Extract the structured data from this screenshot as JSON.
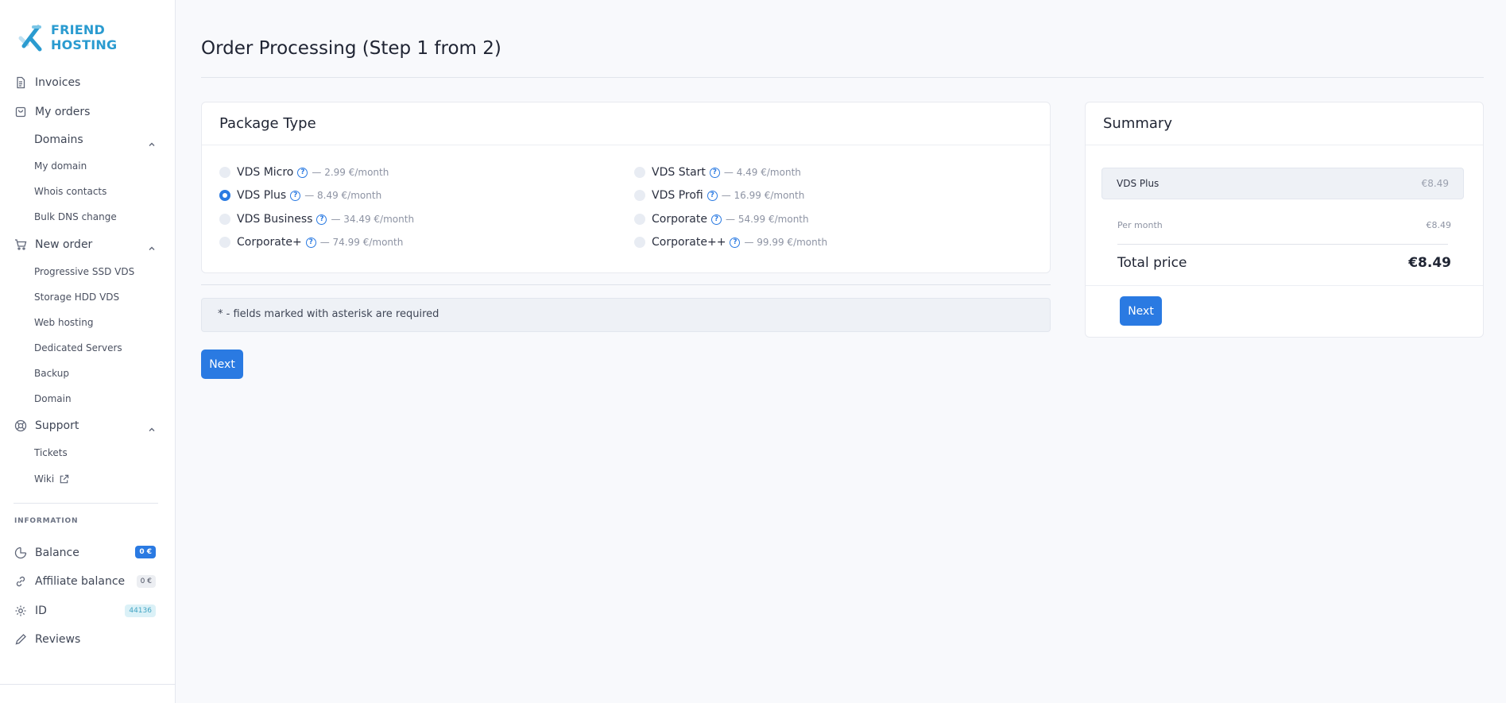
{
  "brand": {
    "name": "FRIEND HOSTING",
    "accent": "#2a9bd0",
    "primary": "#2a7ae2"
  },
  "sidebar": {
    "invoices": "Invoices",
    "my_orders": "My orders",
    "domains": {
      "label": "Domains",
      "items": [
        "My domain",
        "Whois contacts",
        "Bulk DNS change"
      ]
    },
    "new_order": {
      "label": "New order",
      "items": [
        "Progressive SSD VDS",
        "Storage HDD VDS",
        "Web hosting",
        "Dedicated Servers",
        "Backup",
        "Domain"
      ]
    },
    "support": {
      "label": "Support",
      "items": [
        "Tickets",
        "Wiki"
      ]
    },
    "information_label": "INFORMATION",
    "balance": {
      "label": "Balance",
      "badge": "0 €"
    },
    "affiliate": {
      "label": "Affiliate balance",
      "badge": "0 €"
    },
    "id": {
      "label": "ID",
      "badge": "44136"
    },
    "reviews": "Reviews"
  },
  "page": {
    "title": "Order Processing (Step 1 from 2)",
    "package_card_title": "Package Type",
    "packages": [
      {
        "name": "VDS Micro",
        "price": "— 2.99 €/month",
        "selected": false
      },
      {
        "name": "VDS Plus",
        "price": "— 8.49 €/month",
        "selected": true
      },
      {
        "name": "VDS Business",
        "price": "— 34.49 €/month",
        "selected": false
      },
      {
        "name": "Corporate+",
        "price": "— 74.99 €/month",
        "selected": false
      },
      {
        "name": "VDS Start",
        "price": "— 4.49 €/month",
        "selected": false
      },
      {
        "name": "VDS Profi",
        "price": "— 16.99 €/month",
        "selected": false
      },
      {
        "name": "Corporate",
        "price": "— 54.99 €/month",
        "selected": false
      },
      {
        "name": "Corporate++",
        "price": "— 99.99 €/month",
        "selected": false
      }
    ],
    "required_note": "* - fields marked with asterisk are required",
    "next_label": "Next"
  },
  "summary": {
    "title": "Summary",
    "selected_name": "VDS Plus",
    "selected_price": "€8.49",
    "per_month_label": "Per month",
    "per_month_value": "€8.49",
    "total_label": "Total price",
    "total_value": "€8.49",
    "next_label": "Next"
  }
}
